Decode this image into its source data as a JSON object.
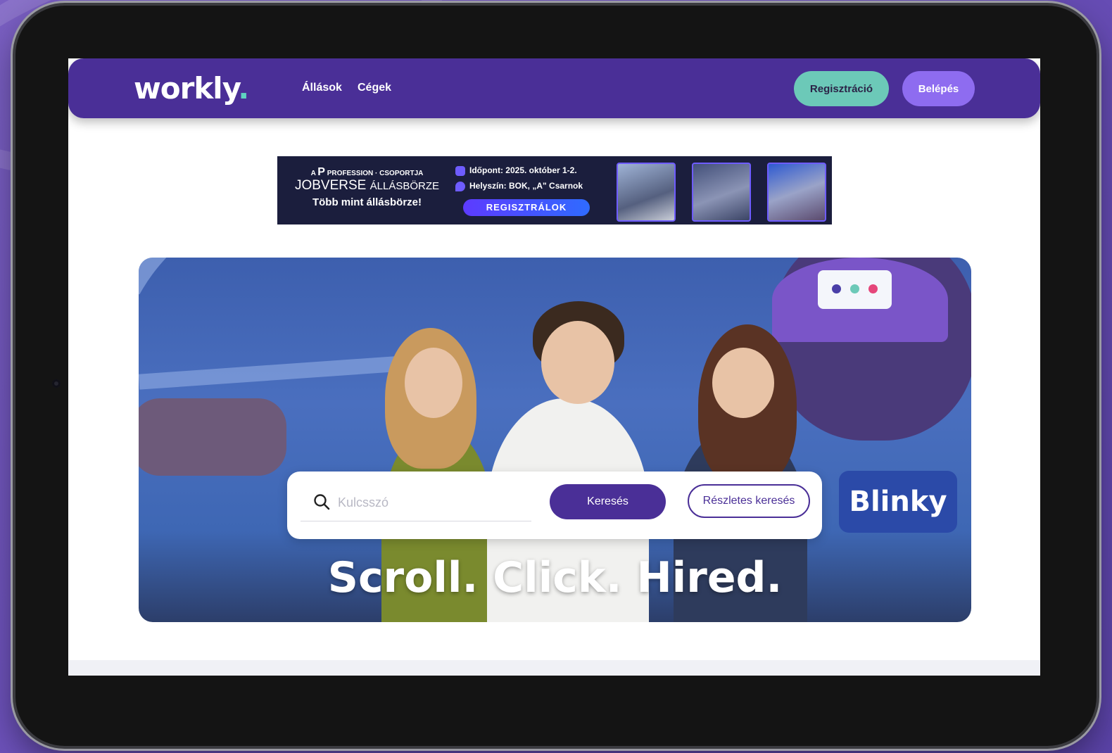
{
  "navbar": {
    "logo": "workly",
    "logo_dot": ".",
    "links": [
      "Állások",
      "Cégek"
    ],
    "register_label": "Regisztráció",
    "login_label": "Belépés"
  },
  "banner": {
    "brand_prefix": "A",
    "brand_logo": "P",
    "brand_rest": "PROFESSION · CSOPORTJA",
    "title": "JOBVERSE",
    "title_suffix": "ÁLLÁSBÖRZE",
    "subtitle": "Több mint állásbörze!",
    "date": "Időpont: 2025. október 1-2.",
    "location": "Helyszín: BOK, „A\" Csarnok",
    "cta": "REGISZTRÁLOK"
  },
  "hero": {
    "tagline": "Scroll. Click. Hired.",
    "mascot_label": "Blinky"
  },
  "search": {
    "placeholder": "Kulcsszó",
    "search_button": "Keresés",
    "advanced_button": "Részletes keresés"
  },
  "colors": {
    "primary": "#4a2f97",
    "accent_teal": "#6cc9b8",
    "accent_purple": "#8e6cf0"
  }
}
